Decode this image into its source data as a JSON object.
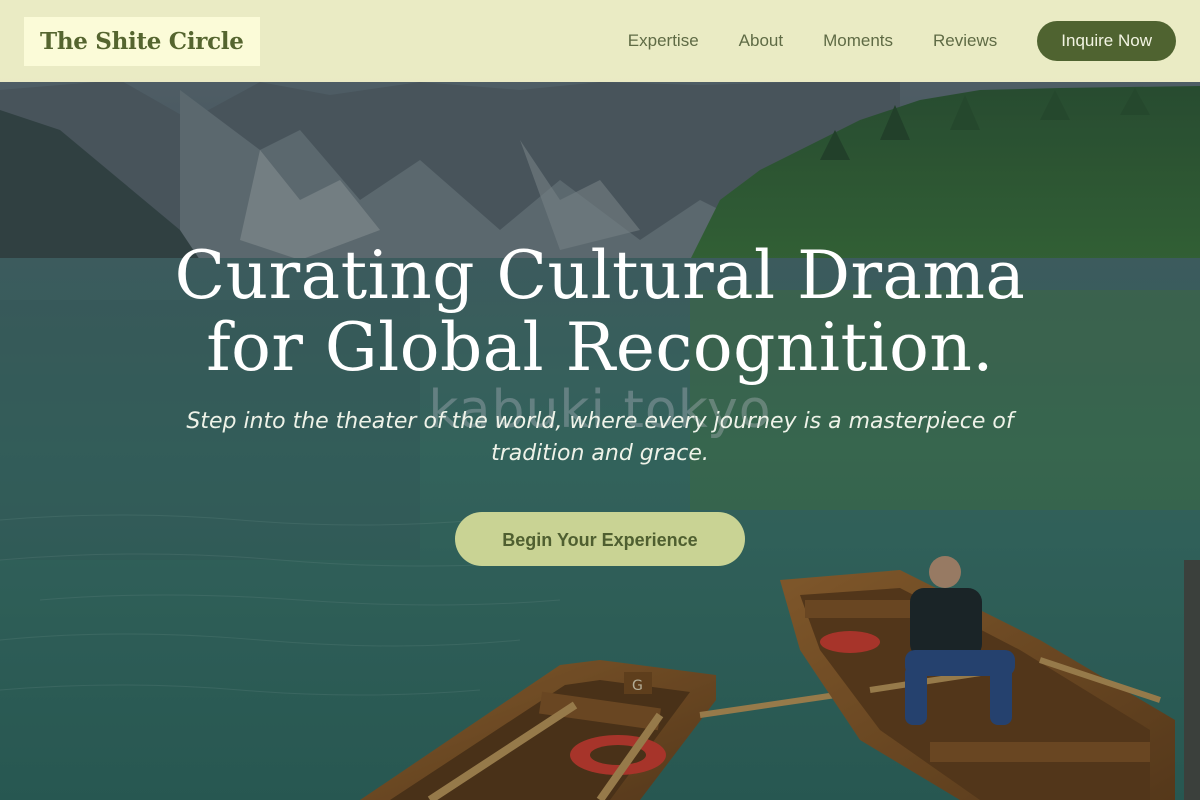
{
  "header": {
    "logo": "The Shite Circle",
    "nav": [
      {
        "label": "Expertise"
      },
      {
        "label": "About"
      },
      {
        "label": "Moments"
      },
      {
        "label": "Reviews"
      }
    ],
    "cta_label": "Inquire Now"
  },
  "hero": {
    "title_line1": "Curating Cultural Drama",
    "title_line2": "for Global Recognition.",
    "watermark": "kabuki tokyo",
    "subtitle": "Step into the theater of the world, where every journey is a masterpiece of tradition and grace.",
    "cta_label": "Begin Your Experience"
  },
  "colors": {
    "header_bg": "#f0f0c8",
    "logo_text": "#55652f",
    "nav_cta_bg": "#4f6330",
    "hero_cta_bg": "#c9d394",
    "hero_cta_text": "#4f5f30"
  }
}
